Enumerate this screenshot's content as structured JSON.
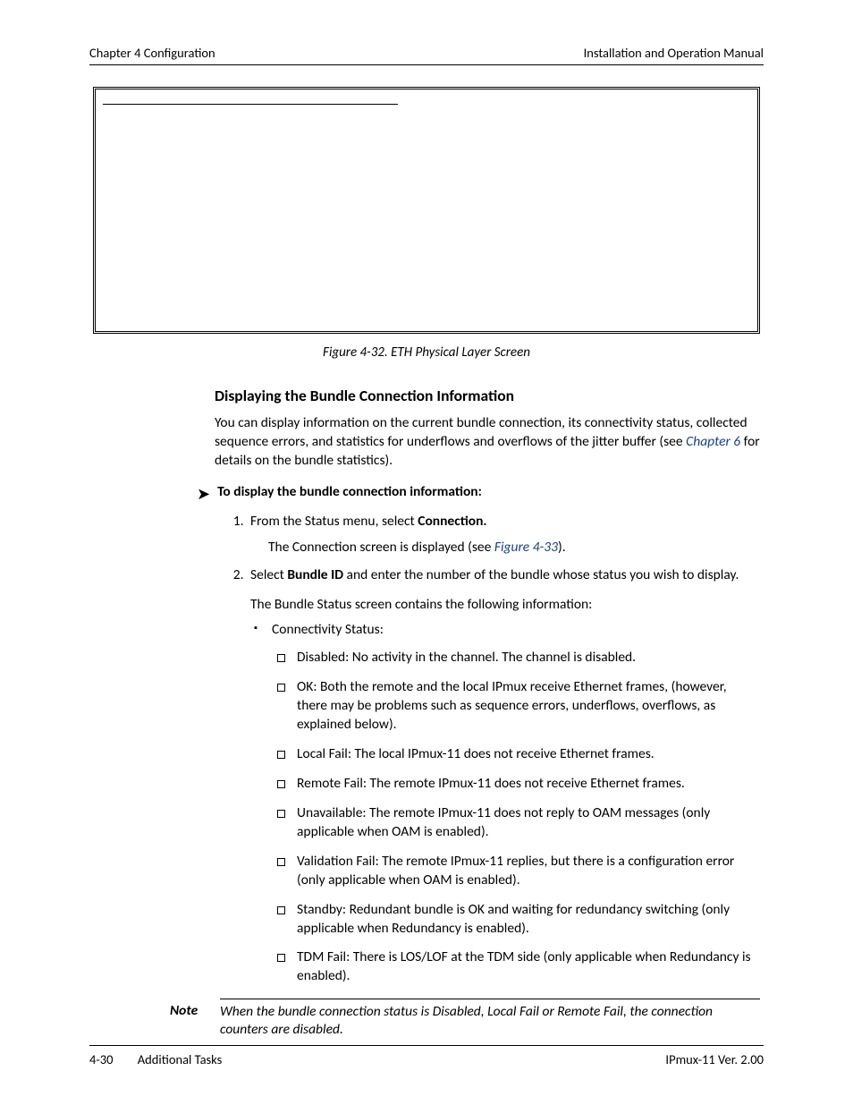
{
  "header": {
    "left": "Chapter 4  Configuration",
    "right": "Installation and Operation Manual"
  },
  "figure": {
    "caption": "Figure 4-32.  ETH Physical Layer Screen"
  },
  "section": {
    "heading": "Displaying the Bundle Connection Information",
    "intro_1": "You can display information on the current bundle connection, its connectivity status, collected sequence errors, and statistics for underflows and overflows of the jitter buffer (see ",
    "intro_link": "Chapter 6",
    "intro_2": " for details on the bundle statistics)."
  },
  "procedure": {
    "title": "To display the bundle connection information:",
    "step1_a": "From the Status menu, select ",
    "step1_b": "Connection.",
    "step1_sub_a": "The Connection screen is displayed (see ",
    "step1_sub_link": "Figure 4-33",
    "step1_sub_b": ").",
    "step2_a": "Select ",
    "step2_b": "Bundle ID",
    "step2_c": " and enter the number of the bundle whose status you wish to display.",
    "step2_sub": "The Bundle Status screen contains the following information:",
    "bullet1": "Connectivity Status:",
    "sq1": "Disabled: No activity in the channel. The channel is disabled.",
    "sq2": "OK: Both the remote and the local IPmux receive Ethernet frames, (however, there may be problems such as sequence errors, underflows, overflows, as explained below).",
    "sq3": "Local Fail: The local IPmux-11 does not receive Ethernet frames.",
    "sq4": "Remote Fail: The remote IPmux-11 does not receive Ethernet frames.",
    "sq5": "Unavailable: The remote IPmux-11 does not reply to OAM messages (only applicable when OAM is enabled).",
    "sq6": "Validation Fail: The remote IPmux-11 replies, but there is a configuration error (only applicable when OAM is enabled).",
    "sq7": "Standby: Redundant bundle is OK and waiting for redundancy switching (only applicable when Redundancy is enabled).",
    "sq8": "TDM Fail: There is LOS/LOF at the TDM side (only applicable when Redundancy is enabled)."
  },
  "note": {
    "label": "Note",
    "text": "When the bundle connection status is Disabled, Local Fail or Remote Fail, the connection counters are disabled."
  },
  "footer": {
    "page": "4-30",
    "section": "Additional Tasks",
    "right": "IPmux-11 Ver. 2.00"
  }
}
